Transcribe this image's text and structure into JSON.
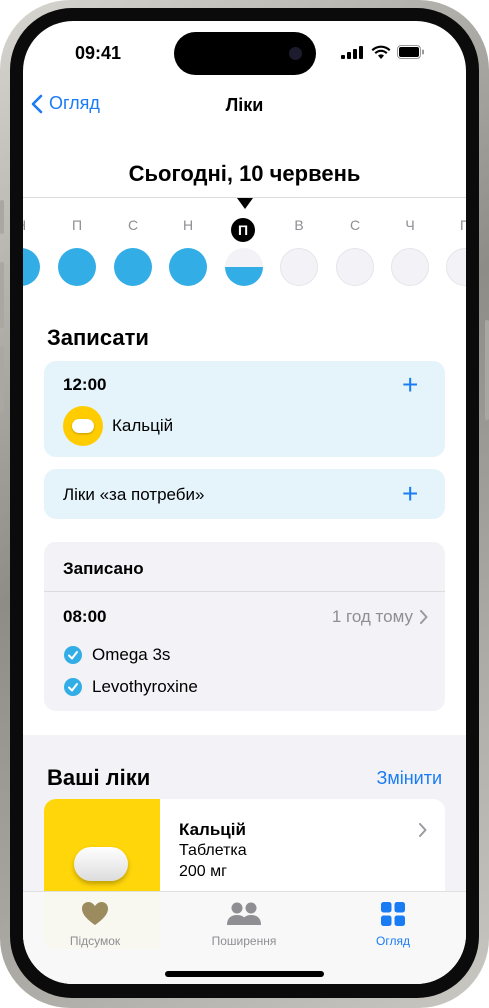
{
  "status": {
    "time": "09:41"
  },
  "nav": {
    "back_label": "Огляд",
    "title": "Ліки"
  },
  "date_title": "Сьогодні, 10 червень",
  "week": {
    "days": [
      "Н",
      "П",
      "С",
      "Н",
      "П",
      "В",
      "С",
      "Ч",
      "П"
    ],
    "states": [
      "full",
      "full",
      "full",
      "full",
      "half",
      "empty",
      "empty",
      "empty",
      "empty"
    ]
  },
  "record": {
    "heading": "Записати",
    "scheduled": {
      "time": "12:00",
      "medication": "Кальцій"
    },
    "as_needed": "Ліки «за потреби»"
  },
  "logged": {
    "heading": "Записано",
    "time": "08:00",
    "ago": "1 год тому",
    "items": [
      "Omega 3s",
      "Levothyroxine"
    ]
  },
  "your_meds": {
    "heading": "Ваші ліки",
    "edit": "Змінити",
    "card": {
      "name": "Кальцій",
      "form": "Таблетка",
      "dose": "200 мг"
    }
  },
  "tabs": [
    {
      "label": "Підсумок",
      "active": false
    },
    {
      "label": "Поширення",
      "active": false
    },
    {
      "label": "Огляд",
      "active": true
    }
  ],
  "colors": {
    "accent": "#1a7cf5",
    "dose_complete": "#32ade6",
    "pill_bg": "#ffcc00"
  }
}
